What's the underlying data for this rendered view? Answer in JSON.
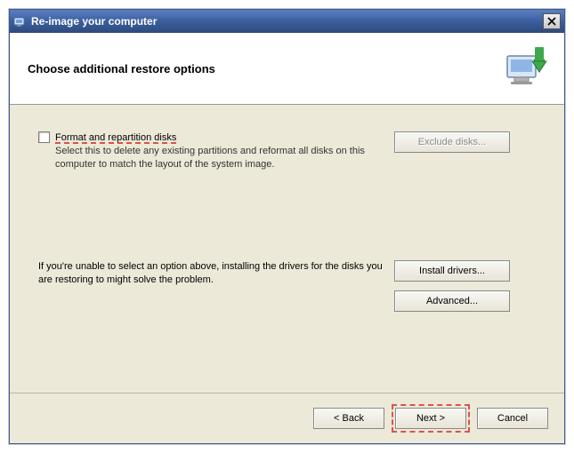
{
  "window": {
    "title": "Re-image your computer"
  },
  "header": {
    "title": "Choose additional restore options"
  },
  "option": {
    "checkbox_label": "Format and repartition disks",
    "description": "Select this to delete any existing partitions and reformat all disks on this computer to match the layout of the system image.",
    "exclude_button": "Exclude disks..."
  },
  "drivers": {
    "text": "If you're unable to select an option above, installing the drivers for the disks you are restoring to might solve the problem.",
    "install_button": "Install drivers...",
    "advanced_button": "Advanced..."
  },
  "footer": {
    "back": "< Back",
    "next": "Next >",
    "cancel": "Cancel"
  }
}
